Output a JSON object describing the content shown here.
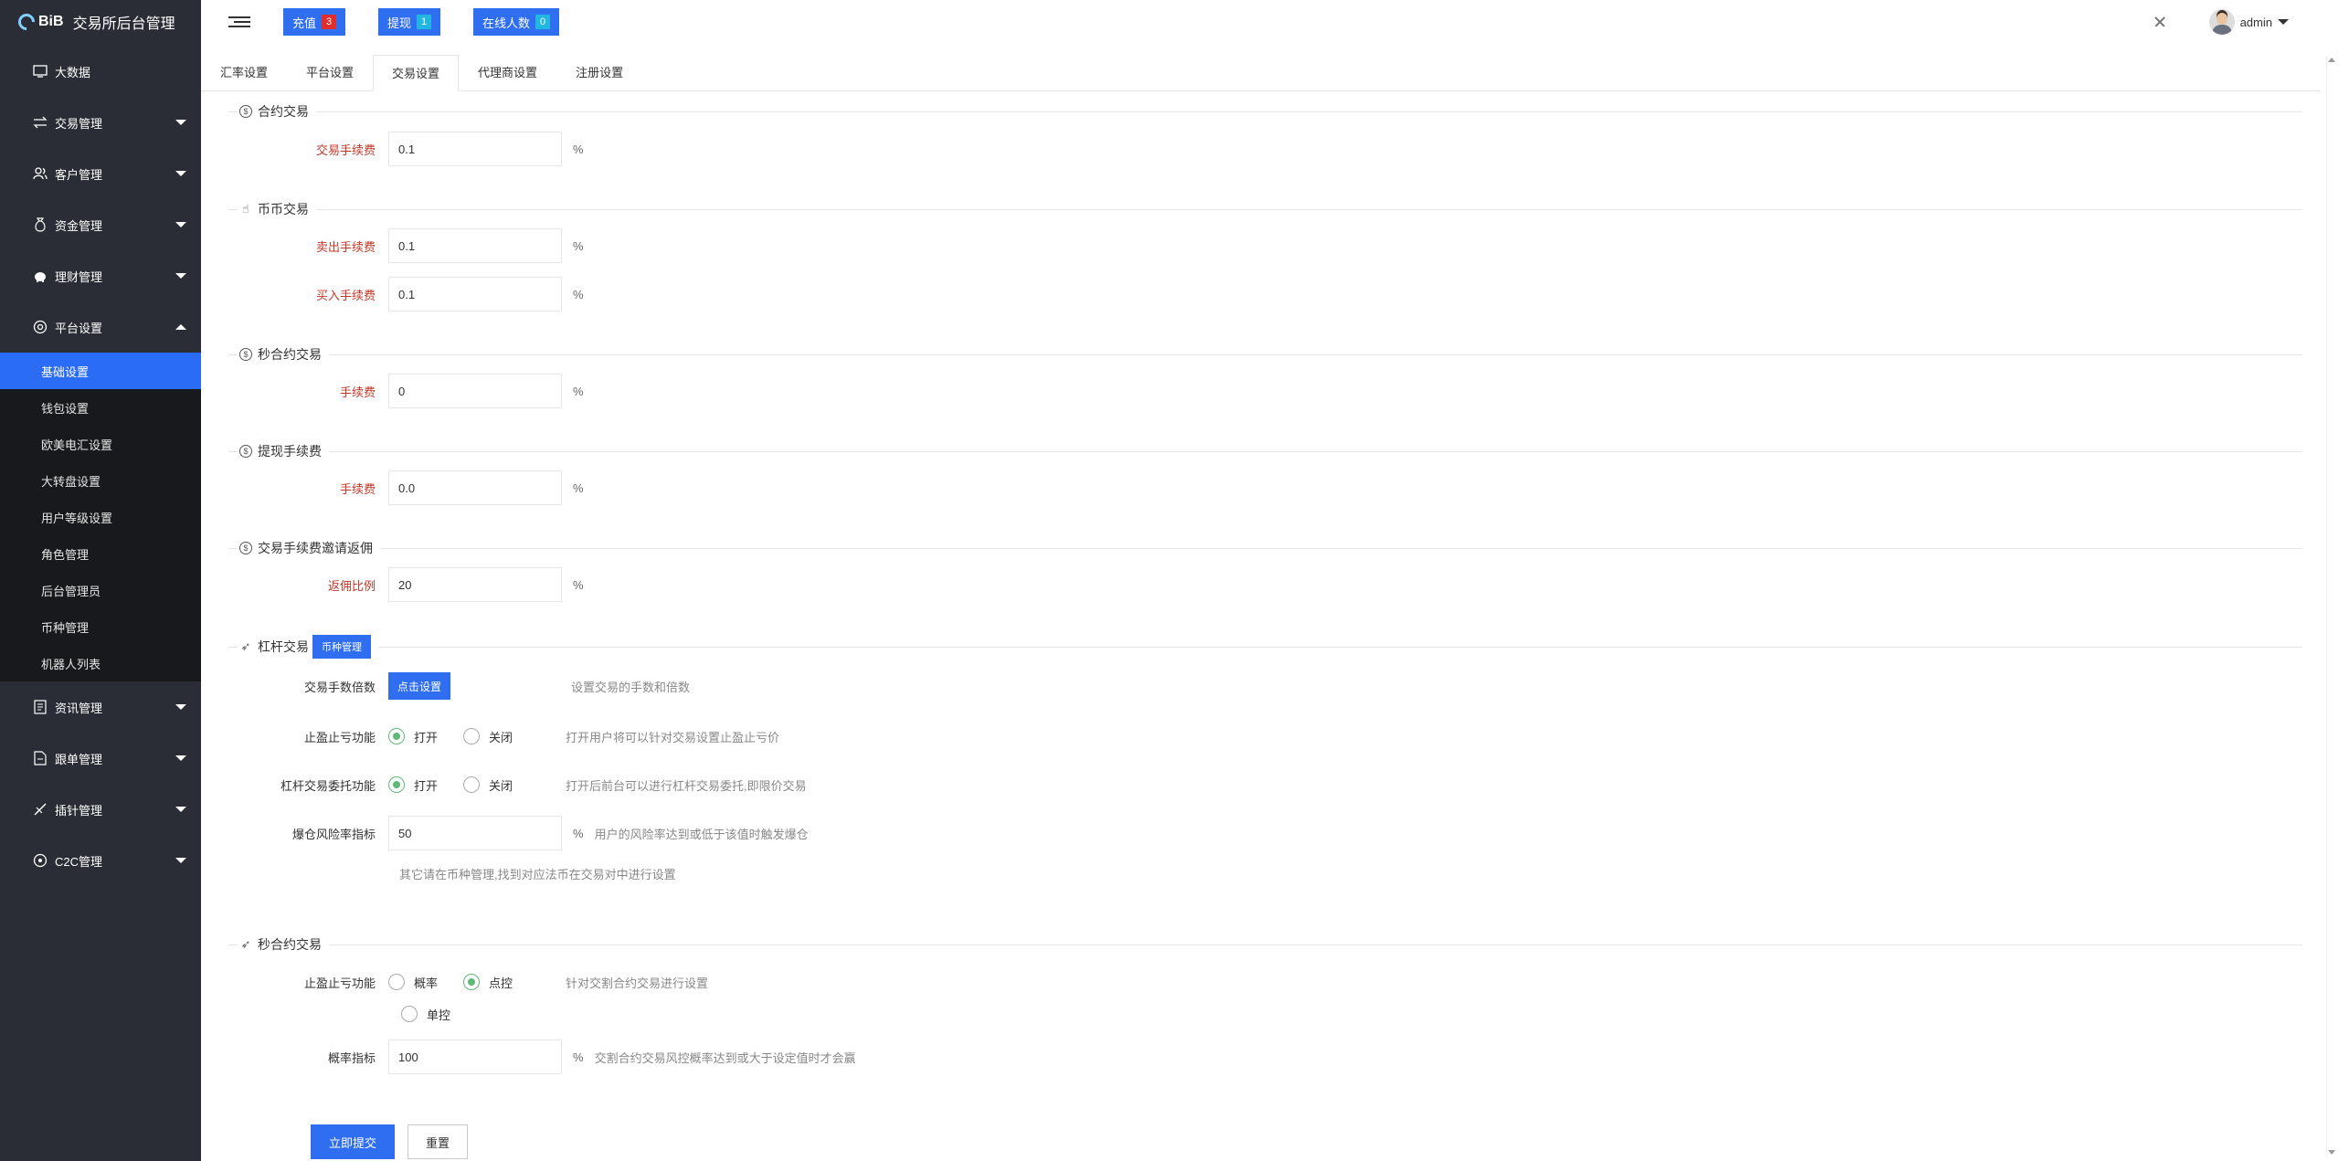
{
  "brand": {
    "logo_text": "BiB",
    "title": "交易所后台管理"
  },
  "sidebar": {
    "items": [
      {
        "label": "大数据",
        "icon": "monitor-icon"
      },
      {
        "label": "交易管理",
        "icon": "swap-icon"
      },
      {
        "label": "客户管理",
        "icon": "users-icon"
      },
      {
        "label": "资金管理",
        "icon": "money-bag-icon"
      },
      {
        "label": "理财管理",
        "icon": "piggy-bank-icon"
      },
      {
        "label": "平台设置",
        "icon": "settings-circle-icon"
      },
      {
        "label": "资讯管理",
        "icon": "news-icon"
      },
      {
        "label": "跟单管理",
        "icon": "document-icon"
      },
      {
        "label": "插针管理",
        "icon": "needle-icon"
      },
      {
        "label": "C2C管理",
        "icon": "target-icon"
      }
    ],
    "sub_items": [
      "基础设置",
      "钱包设置",
      "欧美电汇设置",
      "大转盘设置",
      "用户等级设置",
      "角色管理",
      "后台管理员",
      "币种管理",
      "机器人列表"
    ]
  },
  "topbar": {
    "buttons": [
      {
        "label": "充值",
        "count": "3"
      },
      {
        "label": "提现",
        "count": "1"
      },
      {
        "label": "在线人数",
        "count": "0"
      }
    ],
    "username": "admin"
  },
  "tabs": [
    "汇率设置",
    "平台设置",
    "交易设置",
    "代理商设置",
    "注册设置"
  ],
  "sections": {
    "contract": {
      "title": "合约交易",
      "fee_label": "交易手续费",
      "fee_value": "0.1"
    },
    "coin": {
      "title": "币币交易",
      "sell_label": "卖出手续费",
      "sell_value": "0.1",
      "buy_label": "买入手续费",
      "buy_value": "0.1"
    },
    "second_contract": {
      "title": "秒合约交易",
      "fee_label": "手续费",
      "fee_value": "0"
    },
    "withdraw": {
      "title": "提现手续费",
      "fee_label": "手续费",
      "fee_value": "0.0"
    },
    "rebate": {
      "title": "交易手续费邀请返佣",
      "ratio_label": "返佣比例",
      "ratio_value": "20"
    },
    "leverage": {
      "title": "杠杆交易",
      "coin_btn": "币种管理",
      "multiplier_label": "交易手数倍数",
      "multiplier_btn": "点击设置",
      "multiplier_hint": "设置交易的手数和倍数",
      "tpsl_label": "止盈止亏功能",
      "tpsl_hint": "打开用户将可以针对交易设置止盈止亏价",
      "entrust_label": "杠杆交易委托功能",
      "entrust_hint": "打开后前台可以进行杠杆交易委托,即限价交易",
      "risk_label": "爆仓风险率指标",
      "risk_value": "50",
      "risk_hint": "用户的风险率达到或低于该值时触发爆仓",
      "note": "其它请在币种管理,找到对应法币在交易对中进行设置"
    },
    "second_contract2": {
      "title": "秒合约交易",
      "tpsl_label": "止盈止亏功能",
      "tpsl_hint": "针对交割合约交易进行设置",
      "prob_label": "概率指标",
      "prob_value": "100",
      "prob_hint": "交割合约交易风控概率达到或大于设定值时才会赢"
    }
  },
  "radio": {
    "open": "打开",
    "close": "关闭",
    "prob": "概率",
    "point": "点控",
    "single": "单控"
  },
  "units": {
    "percent": "%"
  },
  "actions": {
    "submit": "立即提交",
    "reset": "重置"
  }
}
